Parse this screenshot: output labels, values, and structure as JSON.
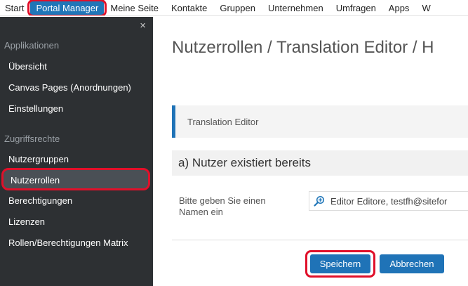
{
  "topnav": {
    "items": [
      "Start",
      "Portal Manager",
      "Meine Seite",
      "Kontakte",
      "Gruppen",
      "Unternehmen",
      "Umfragen",
      "Apps",
      "W"
    ]
  },
  "sidebar": {
    "close_icon": "×",
    "sections": [
      {
        "title": "Applikationen",
        "items": [
          "Übersicht",
          "Canvas Pages (Anordnungen)",
          "Einstellungen"
        ]
      },
      {
        "title": "Zugriffsrechte",
        "items": [
          "Nutzergruppen",
          "Nutzerrollen",
          "Berechtigungen",
          "Lizenzen",
          "Rollen/Berechtigungen Matrix"
        ]
      }
    ]
  },
  "main": {
    "title": "Nutzerrollen / Translation Editor / H",
    "breadcrumb_box": "Translation Editor",
    "section_heading": "a) Nutzer existiert bereits",
    "field_label": "Bitte geben Sie einen Namen ein",
    "field_value": "Editor Editore, testfh@sitefor",
    "save_label": "Speichern",
    "cancel_label": "Abbrechen"
  },
  "colors": {
    "accent": "#1f73b7",
    "highlight": "#e0102a",
    "sidebar_bg": "#2d3033"
  },
  "icons": {
    "field_icon": "search-add-icon",
    "close": "close-icon"
  }
}
